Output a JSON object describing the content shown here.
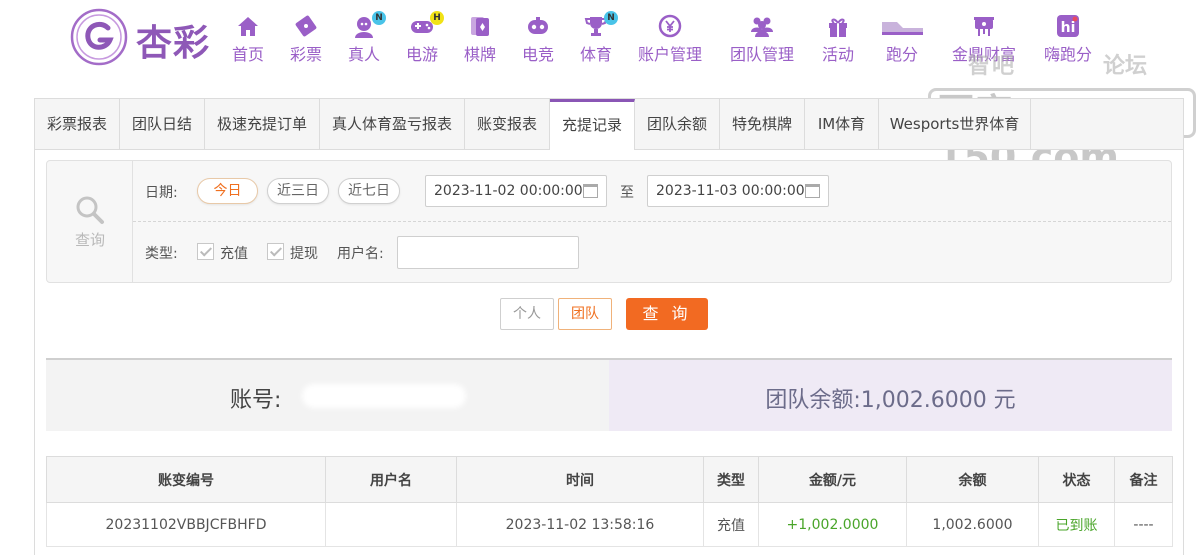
{
  "brand": {
    "name": "杏彩"
  },
  "nav": [
    {
      "label": "首页",
      "icon": "home-icon",
      "badge": ""
    },
    {
      "label": "彩票",
      "icon": "lottery-ticket-icon",
      "badge": ""
    },
    {
      "label": "真人",
      "icon": "live-dealer-icon",
      "badge": "N"
    },
    {
      "label": "电游",
      "icon": "gamepad-icon",
      "badge": "H"
    },
    {
      "label": "棋牌",
      "icon": "cards-icon",
      "badge": ""
    },
    {
      "label": "电竞",
      "icon": "esports-controller-icon",
      "badge": ""
    },
    {
      "label": "体育",
      "icon": "trophy-icon",
      "badge": "N"
    },
    {
      "label": "账户管理",
      "icon": "yen-coin-icon",
      "badge": ""
    },
    {
      "label": "团队管理",
      "icon": "team-icon",
      "badge": ""
    },
    {
      "label": "活动",
      "icon": "gift-icon",
      "badge": ""
    },
    {
      "label": "跑分",
      "icon": "running-shoe-icon",
      "badge": ""
    },
    {
      "label": "金鼎财富",
      "icon": "tripod-icon",
      "badge": ""
    },
    {
      "label": "嗨跑分",
      "icon": "hi-app-icon",
      "badge": ""
    }
  ],
  "watermark": {
    "line1": "智吧",
    "line1b": "论坛",
    "main": "国家150.com"
  },
  "tabs": [
    {
      "label": "彩票报表",
      "active": false
    },
    {
      "label": "团队日结",
      "active": false
    },
    {
      "label": "极速充提订单",
      "active": false
    },
    {
      "label": "真人体育盈亏报表",
      "active": false
    },
    {
      "label": "账变报表",
      "active": false
    },
    {
      "label": "充提记录",
      "active": true
    },
    {
      "label": "团队余额",
      "active": false
    },
    {
      "label": "特免棋牌",
      "active": false
    },
    {
      "label": "IM体育",
      "active": false
    },
    {
      "label": "Wesports世界体育",
      "active": false
    }
  ],
  "query": {
    "side_label": "查询",
    "date_label": "日期:",
    "quick_ranges": [
      "今日",
      "近三日",
      "近七日"
    ],
    "active_range": "今日",
    "start_date": "2023-11-02 00:00:00",
    "to_label": "至",
    "end_date": "2023-11-03 00:00:00",
    "type_label": "类型:",
    "type_options": [
      "充值",
      "提现"
    ],
    "username_label": "用户名:",
    "username_value": ""
  },
  "scope": {
    "personal": "个人",
    "team": "团队",
    "selected": "团队"
  },
  "search_button": "查 询",
  "summary": {
    "account_label": "账号:",
    "team_balance": "团队余额:1,002.6000 元"
  },
  "table": {
    "headers": [
      "账变编号",
      "用户名",
      "时间",
      "类型",
      "金额/元",
      "余额",
      "状态",
      "备注"
    ],
    "rows": [
      [
        "20231102VBBJCFBHFD",
        "",
        "2023-11-02 13:58:16",
        "充值",
        "+1,002.0000",
        "1,002.6000",
        "已到账",
        "----"
      ]
    ]
  },
  "colors": {
    "accent": "#8a56b5",
    "primary_button": "#f26a22",
    "success": "#4aa52a"
  }
}
